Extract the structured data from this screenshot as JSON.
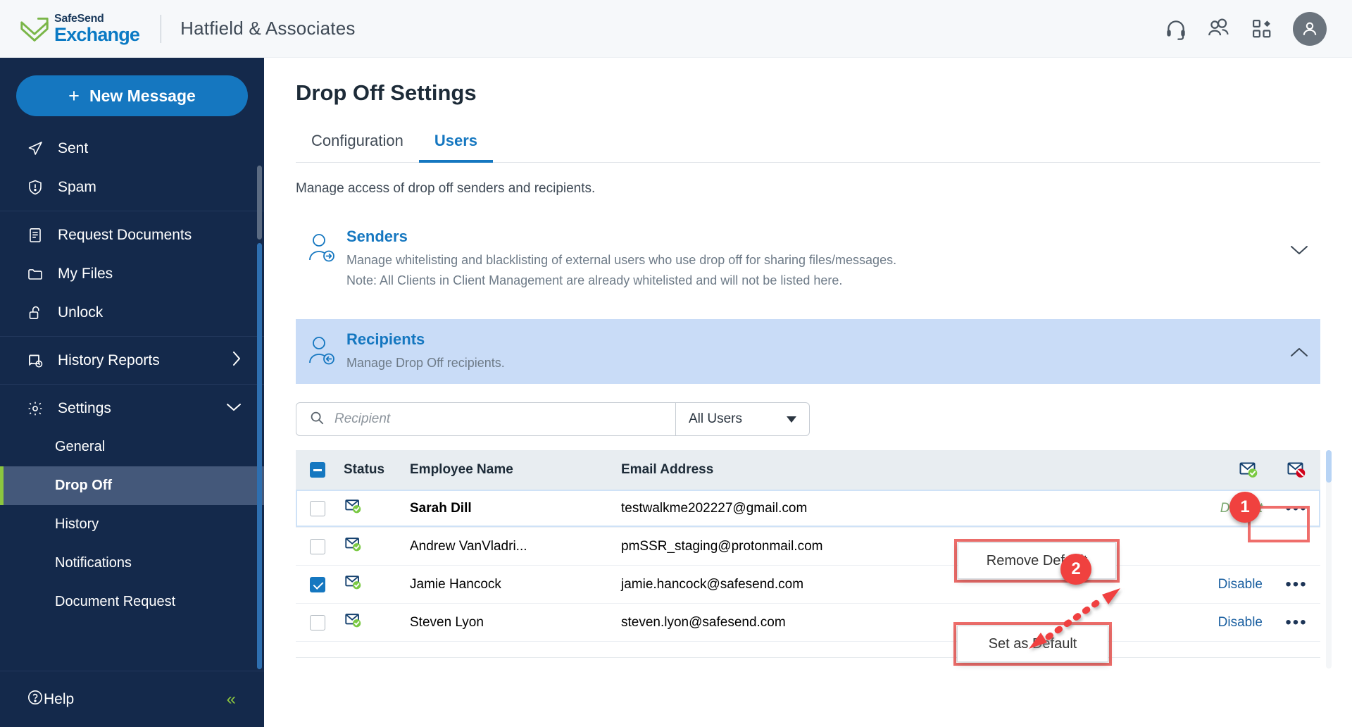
{
  "topbar": {
    "logo_top": "SafeSend",
    "logo_bottom": "Exchange",
    "org_name": "Hatfield & Associates",
    "icons": [
      "headset-icon",
      "people-icon",
      "apps-grid-icon",
      "user-avatar-icon"
    ]
  },
  "sidebar": {
    "new_message_label": "New Message",
    "group1": [
      {
        "label": "Sent",
        "icon": "send-icon"
      },
      {
        "label": "Spam",
        "icon": "shield-alert-icon"
      }
    ],
    "group2": [
      {
        "label": "Request Documents",
        "icon": "document-icon"
      },
      {
        "label": "My Files",
        "icon": "folder-icon"
      },
      {
        "label": "Unlock",
        "icon": "unlock-icon"
      }
    ],
    "group3": [
      {
        "label": "History Reports",
        "icon": "history-report-icon",
        "chevron": "chevron-right-icon"
      }
    ],
    "settings": {
      "label": "Settings",
      "icon": "gear-icon",
      "chevron": "chevron-down-icon"
    },
    "settings_items": [
      {
        "label": "General",
        "active": false
      },
      {
        "label": "Drop Off",
        "active": true
      },
      {
        "label": "History",
        "active": false
      },
      {
        "label": "Notifications",
        "active": false
      },
      {
        "label": "Document Request",
        "active": false
      }
    ],
    "help": {
      "label": "Help",
      "icon": "question-circle-icon",
      "collapse": "«"
    }
  },
  "main": {
    "page_title": "Drop Off Settings",
    "tabs": [
      {
        "label": "Configuration",
        "active": false
      },
      {
        "label": "Users",
        "active": true
      }
    ],
    "subtitle": "Manage access of drop off senders and recipients.",
    "senders": {
      "heading": "Senders",
      "line1": "Manage whitelisting and blacklisting of external users who use drop off for sharing files/messages.",
      "line2": "Note: All Clients in Client Management are already whitelisted and will not be listed here.",
      "chevron": "chevron-down-icon"
    },
    "recipients": {
      "heading": "Recipients",
      "line1": "Manage Drop Off recipients.",
      "chevron": "chevron-up-icon"
    },
    "toolbar": {
      "search_placeholder": "Recipient",
      "search_value": "",
      "filter_value": "All Users"
    },
    "table": {
      "headers": {
        "status": "Status",
        "employee_name": "Employee Name",
        "email_address": "Email Address",
        "enable_icon": "envelope-check-icon",
        "disable_icon": "envelope-block-icon"
      },
      "rows": [
        {
          "checked": false,
          "status_icon": "envelope-check-icon",
          "name": "Sarah Dill",
          "email": "testwalkme202227@gmail.com",
          "action": "Default",
          "action_type": "default",
          "kebab": "more-options-icon"
        },
        {
          "checked": false,
          "status_icon": "envelope-check-icon",
          "name": "Andrew VanVladri...",
          "email": "pmSSR_staging@protonmail.com",
          "action": "",
          "action_type": "none",
          "kebab": ""
        },
        {
          "checked": true,
          "status_icon": "envelope-check-icon",
          "name": "Jamie Hancock",
          "email": "jamie.hancock@safesend.com",
          "action": "Disable",
          "action_type": "disable",
          "kebab": "more-options-icon"
        },
        {
          "checked": false,
          "status_icon": "envelope-check-icon",
          "name": "Steven Lyon",
          "email": "steven.lyon@safesend.com",
          "action": "Disable",
          "action_type": "disable",
          "kebab": "more-options-icon"
        }
      ]
    }
  },
  "annotations": {
    "badge1": "1",
    "badge2": "2",
    "menu_remove_default": "Remove Default",
    "menu_set_as_default": "Set as Default",
    "accent_color": "#f0413f",
    "box_color": "#ef6e6b"
  },
  "colors": {
    "sidebar_bg": "#14294b",
    "primary_blue": "#1577c0",
    "accent_green": "#8cc63f",
    "recipients_bg": "#c9dcf7"
  }
}
